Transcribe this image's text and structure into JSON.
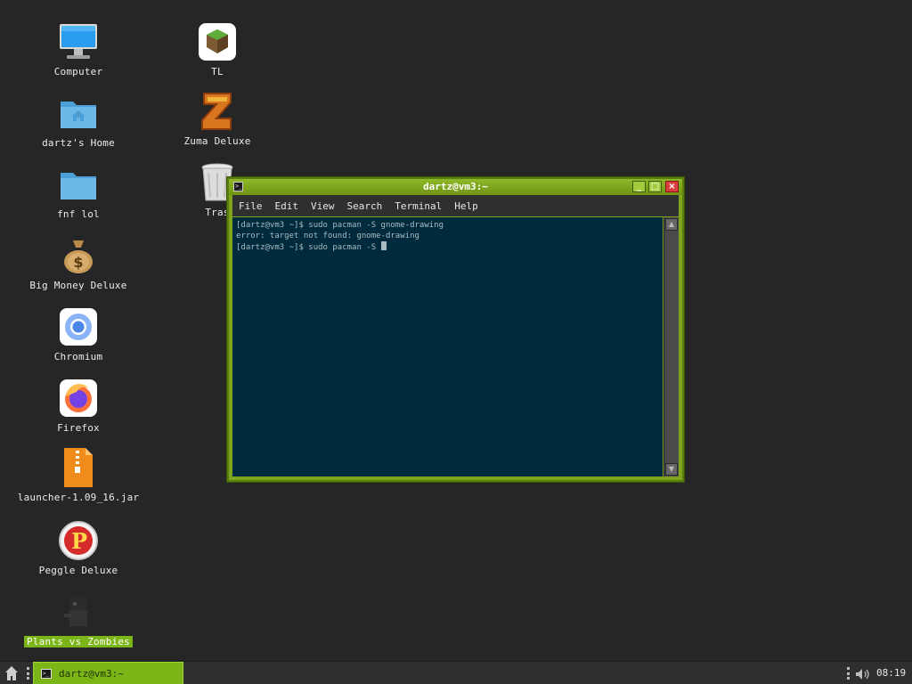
{
  "desktop": {
    "icons": [
      {
        "label": "Computer",
        "icon": "computer-icon"
      },
      {
        "label": "dartz's Home",
        "icon": "home-folder-icon"
      },
      {
        "label": "fnf lol",
        "icon": "folder-icon"
      },
      {
        "label": "Big Money Deluxe",
        "icon": "money-bag-icon"
      },
      {
        "label": "Chromium",
        "icon": "chromium-icon"
      },
      {
        "label": "Firefox",
        "icon": "firefox-icon"
      },
      {
        "label": "launcher-1.09_16.jar",
        "icon": "jar-archive-icon"
      },
      {
        "label": "Peggle Deluxe",
        "icon": "peggle-icon"
      },
      {
        "label": "Plants vs Zombies",
        "icon": "plants-vs-zombies-icon",
        "selected": true
      },
      {
        "label": "TL",
        "icon": "tl-launcher-icon"
      },
      {
        "label": "Zuma Deluxe",
        "icon": "zuma-icon"
      },
      {
        "label": "Tras",
        "icon": "trash-icon"
      }
    ]
  },
  "terminal": {
    "title": "dartz@vm3:~",
    "menu": [
      "File",
      "Edit",
      "View",
      "Search",
      "Terminal",
      "Help"
    ],
    "lines": [
      "[dartz@vm3 ~]$ sudo pacman -S gnome-drawing",
      "error: target not found: gnome-drawing",
      "[dartz@vm3 ~]$ sudo pacman -S "
    ],
    "colors": {
      "frame": "#7fa31c",
      "background": "#002b3c",
      "text": "#a9bcc4"
    }
  },
  "panel": {
    "task_label": "dartz@vm3:~",
    "clock": "08:19",
    "accent": "#7cb518"
  }
}
